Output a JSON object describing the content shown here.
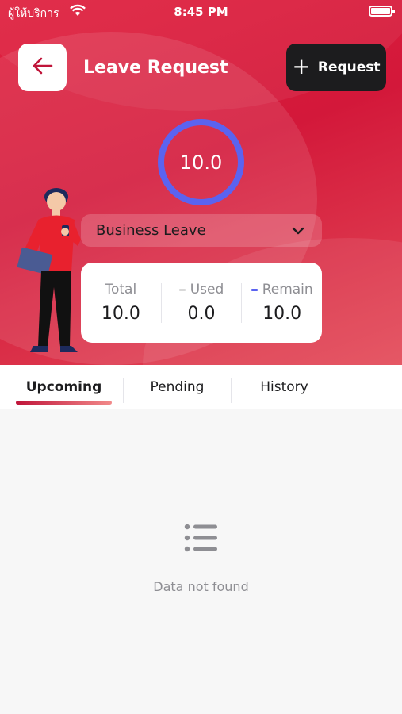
{
  "status_bar": {
    "carrier": "ผู้ให้บริการ",
    "time": "8:45 PM"
  },
  "header": {
    "title": "Leave Request",
    "request_button_label": "Request"
  },
  "summary": {
    "ring_value": "10.0",
    "leave_type": "Business Leave",
    "stats": [
      {
        "label": "Total",
        "value": "10.0",
        "marker_color": ""
      },
      {
        "label": "Used",
        "value": "0.0",
        "marker_color": "#d9d9d9"
      },
      {
        "label": "Remain",
        "value": "10.0",
        "marker_color": "#5b63f0"
      }
    ]
  },
  "tabs": [
    {
      "label": "Upcoming",
      "active": true
    },
    {
      "label": "Pending",
      "active": false
    },
    {
      "label": "History",
      "active": false
    }
  ],
  "empty_state": {
    "icon": "list-icon",
    "message": "Data not found"
  },
  "colors": {
    "accent": "#e0213f",
    "ring": "#5b63f0",
    "dark_button": "#1c1c1e"
  }
}
